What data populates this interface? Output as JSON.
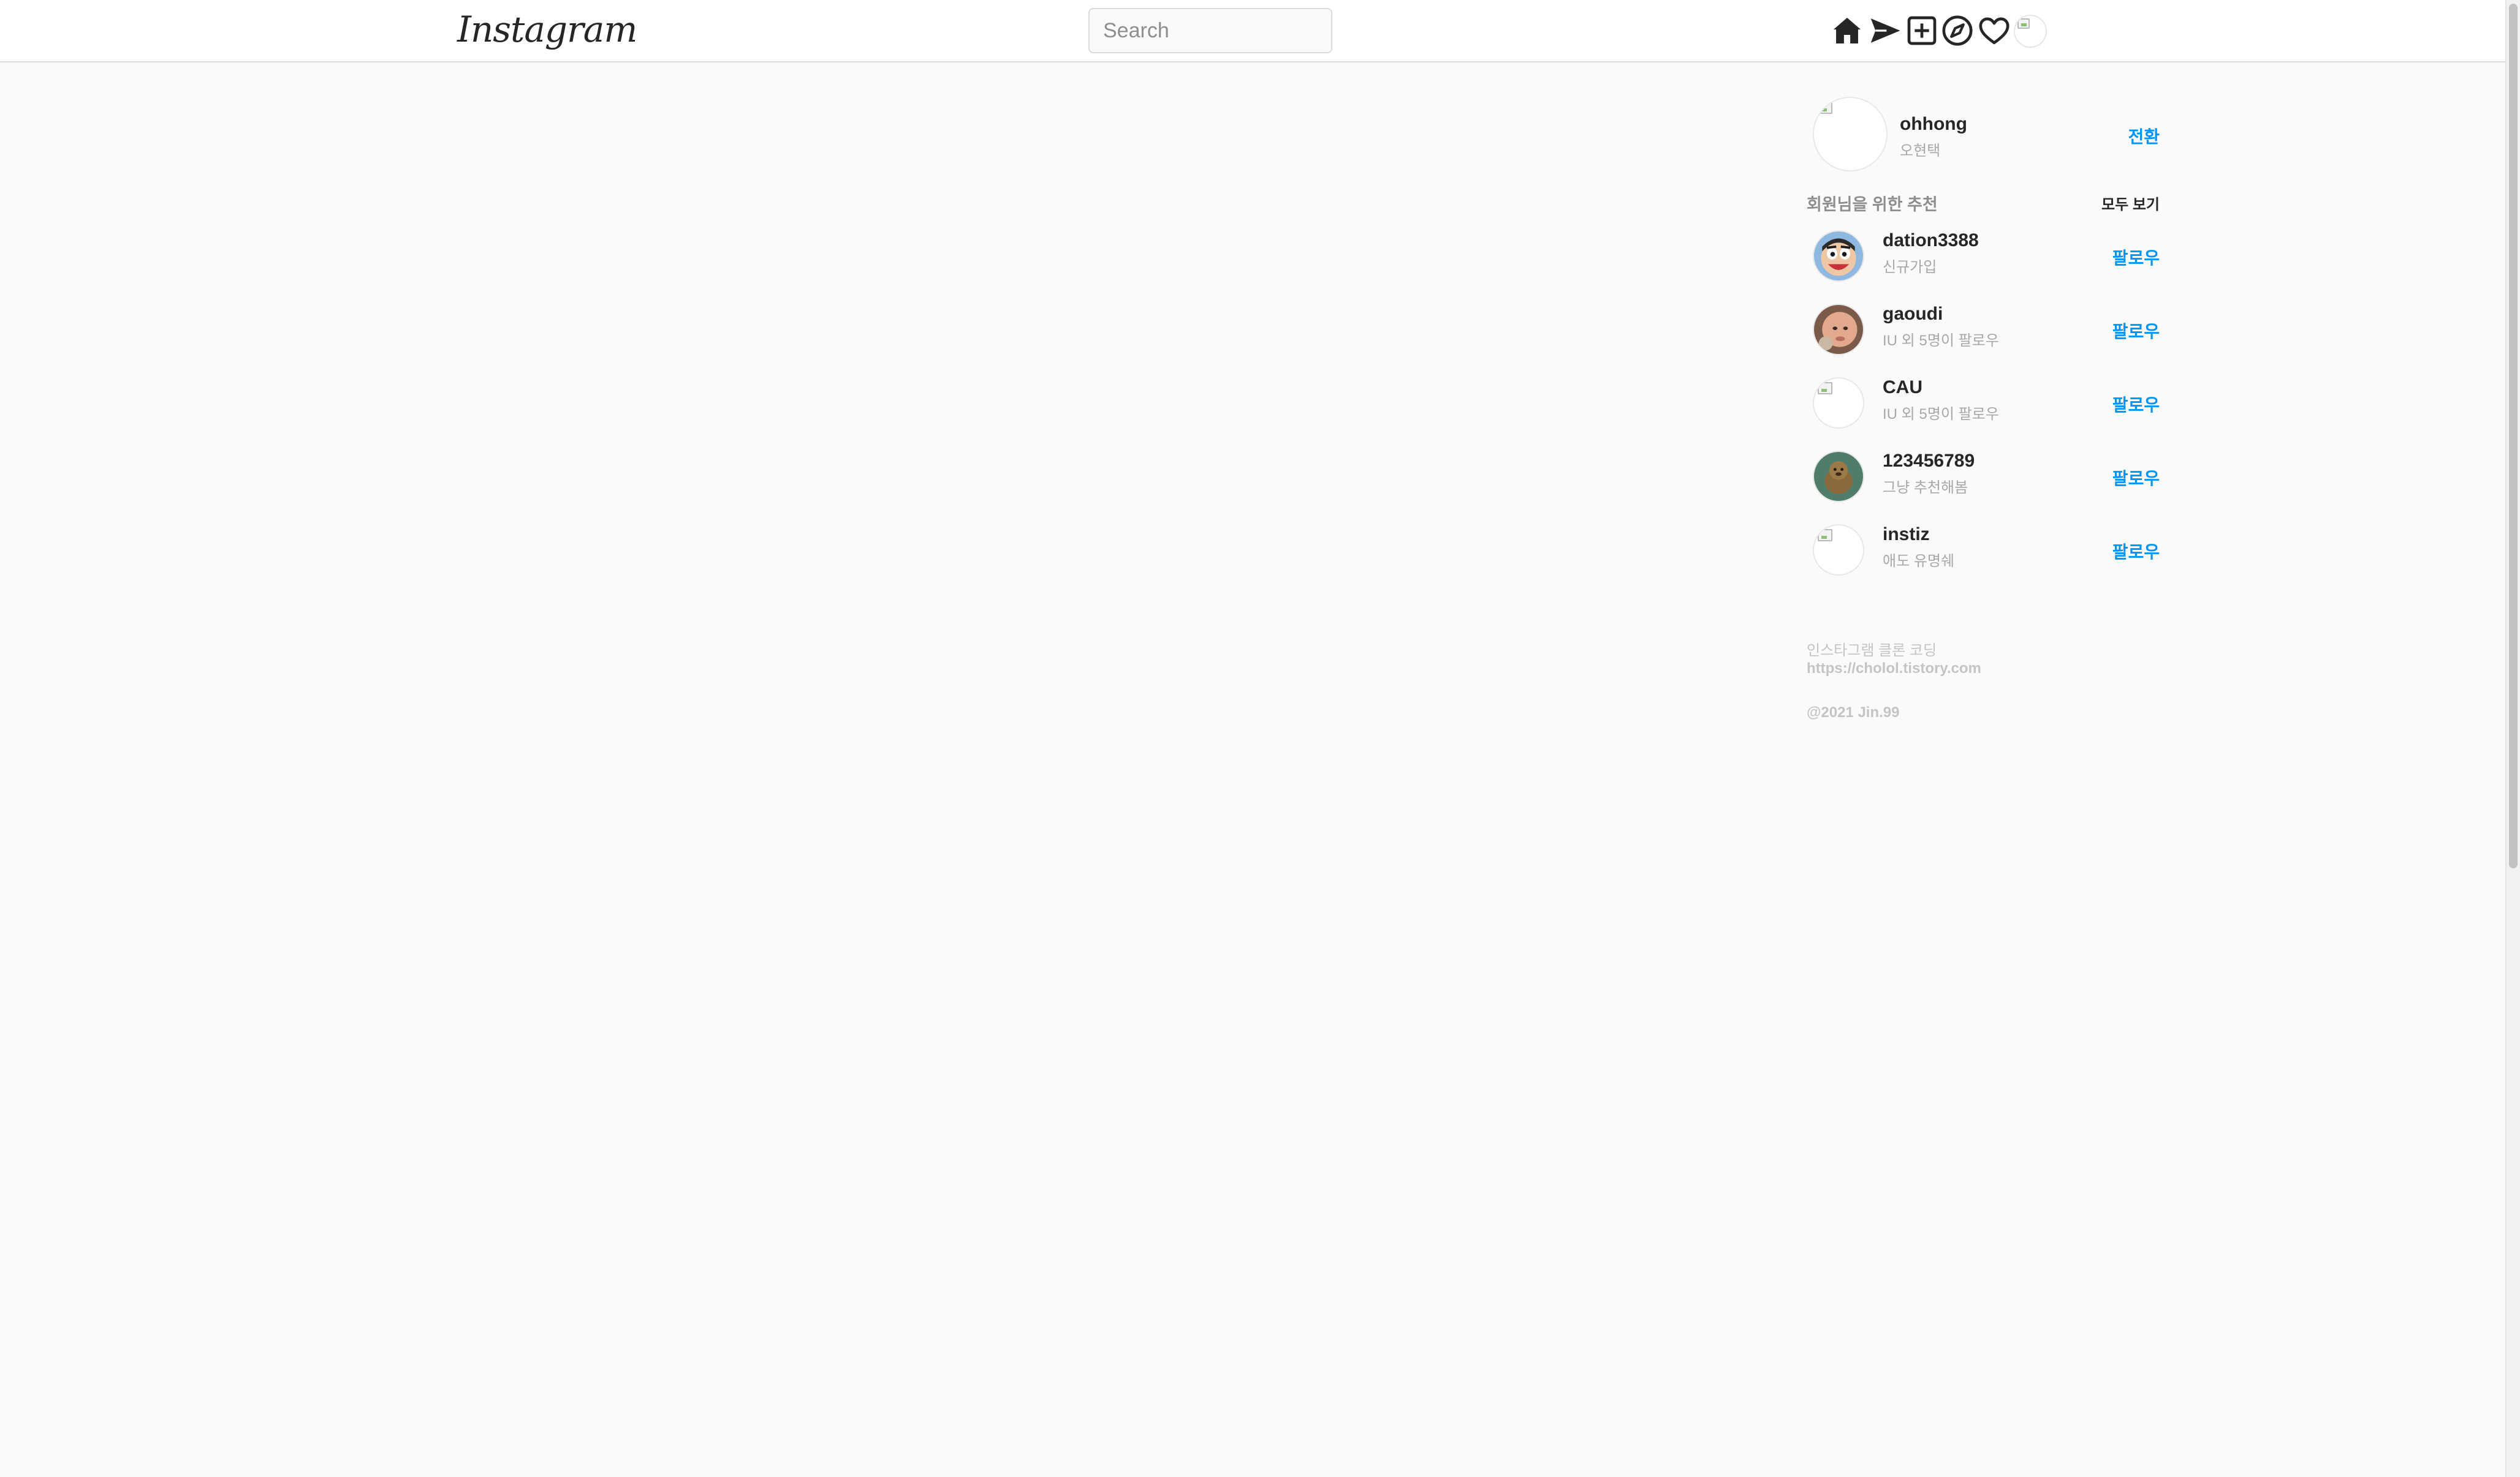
{
  "header": {
    "logo_text": "Instagram",
    "search": {
      "placeholder": "Search",
      "value": ""
    },
    "icons": [
      "home-icon",
      "direct-message-icon",
      "new-post-icon",
      "explore-icon",
      "activity-heart-icon",
      "profile-avatar"
    ]
  },
  "current_user": {
    "username": "ohhong",
    "name": "오현택",
    "switch_label": "전환"
  },
  "suggestions": {
    "title": "회원님을 위한 추천",
    "see_all_label": "모두 보기",
    "follow_label": "팔로우",
    "items": [
      {
        "username": "dation3388",
        "subtitle": "신규가입",
        "avatar": "cartoon-face"
      },
      {
        "username": "gaoudi",
        "subtitle": "IU 외 5명이 팔로우",
        "avatar": "baby-photo"
      },
      {
        "username": "CAU",
        "subtitle": "IU 외 5명이 팔로우",
        "avatar": "broken-image"
      },
      {
        "username": "123456789",
        "subtitle": "그냥 추천해봄",
        "avatar": "animal-photo"
      },
      {
        "username": "instiz",
        "subtitle": "애도 유명쉐",
        "avatar": "broken-image"
      }
    ]
  },
  "footer": {
    "line1": "인스타그램 클론 코딩",
    "link": "https://cholol.tistory.com",
    "copyright": "@2021 Jin.99"
  },
  "colors": {
    "background": "#fafafa",
    "accent": "#0095f6",
    "border": "#dbdbdb",
    "secondary_text": "#8e8e8e"
  }
}
